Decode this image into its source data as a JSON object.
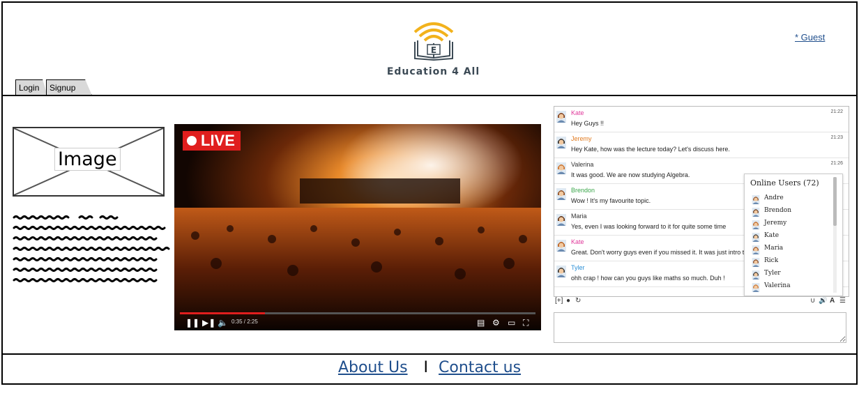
{
  "header": {
    "logo_letter": "E",
    "logo_text": "Education 4 All",
    "guest_link": "* Guest",
    "tabs": [
      "Login",
      "Signup"
    ]
  },
  "left": {
    "image_placeholder": "Image"
  },
  "video": {
    "live_label": "LIVE",
    "time": "0:35 / 2:25",
    "progress": 0.24
  },
  "chat": {
    "messages": [
      {
        "user": "Kate",
        "color": "#e0399b",
        "time": "21:22",
        "text": "Hey Guys !!"
      },
      {
        "user": "Jeremy",
        "color": "#e07a1f",
        "time": "21:23",
        "text": "Hey Kate, how was the lecture today? Let's discuss here."
      },
      {
        "user": "Valerina",
        "color": "#333333",
        "time": "21:26",
        "text": "It was good. We are now studying Algebra."
      },
      {
        "user": "Brendon",
        "color": "#3aa64a",
        "time": "",
        "text": "Wow ! It's my favourite topic."
      },
      {
        "user": "Maria",
        "color": "#333333",
        "time": "",
        "text": "Yes, even I was looking forward to it for quite some time"
      },
      {
        "user": "Kate",
        "color": "#e0399b",
        "time": "",
        "text": "Great. Don't worry guys even if you missed it. It was just intro toca"
      },
      {
        "user": "Tyler",
        "color": "#2a8fd6",
        "time": "",
        "text": "ohh crap ! how can you guys like maths so much. Duh !"
      }
    ],
    "online_title": "Online Users (72)",
    "online_users": [
      "Andre",
      "Brendon",
      "Jeremy",
      "Kate",
      "Maria",
      "Rick",
      "Tyler",
      "Valerina"
    ]
  },
  "footer": {
    "about": "About Us",
    "separator": "I",
    "contact": "Contact us"
  }
}
